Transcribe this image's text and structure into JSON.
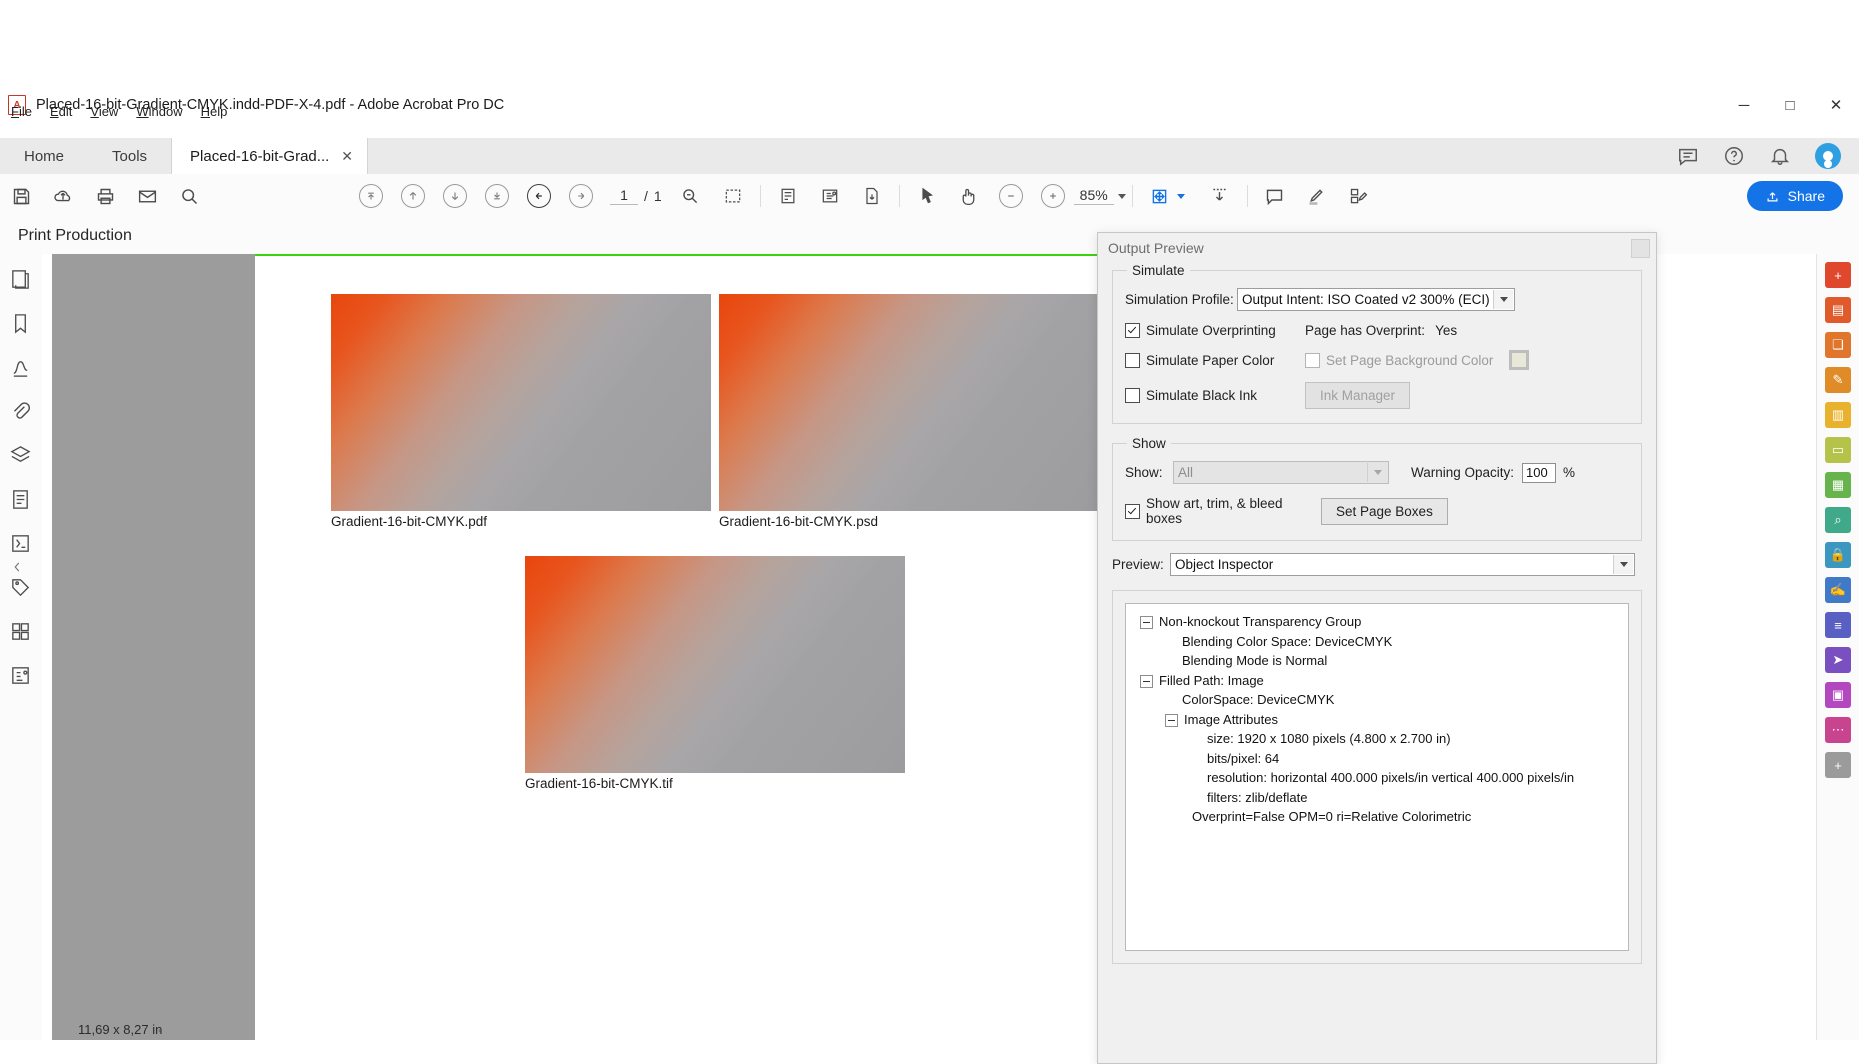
{
  "window": {
    "title": "Placed-16-bit-Gradient-CMYK.indd-PDF-X-4.pdf - Adobe Acrobat Pro DC",
    "app_icon": "pdf-document-icon",
    "minimize": "─",
    "maximize": "□",
    "close": "✕"
  },
  "menubar": {
    "items": [
      {
        "label": "File",
        "accel": "F"
      },
      {
        "label": "Edit",
        "accel": "E"
      },
      {
        "label": "View",
        "accel": "V"
      },
      {
        "label": "Window",
        "accel": "W"
      },
      {
        "label": "Help",
        "accel": "H"
      }
    ]
  },
  "tabs": {
    "home": "Home",
    "tools": "Tools",
    "document": "Placed-16-bit-Grad...",
    "close_glyph": "✕"
  },
  "toolbar": {
    "page_current": "1",
    "page_sep": "/",
    "page_total": "1",
    "zoom_level": "85%",
    "share_label": "Share"
  },
  "print_production": {
    "title": "Print Production"
  },
  "document": {
    "images": [
      {
        "caption": "Gradient-16-bit-CMYK.pdf"
      },
      {
        "caption": "Gradient-16-bit-CMYK.psd"
      },
      {
        "caption": "Gradient-16-bit-CMYK.tif"
      }
    ]
  },
  "statusbar": {
    "page_dimensions": "11,69 x 8,27 in",
    "scroll_left_glyph": "‹",
    "scroll_right_glyph": "›"
  },
  "output_preview": {
    "title": "Output Preview",
    "simulate": {
      "legend": "Simulate",
      "simulation_profile_label": "Simulation Profile:",
      "simulation_profile_value": "Output Intent: ISO Coated v2 300% (ECI)",
      "simulate_overprinting_label": "Simulate Overprinting",
      "simulate_overprinting_checked": true,
      "page_has_overprint_label": "Page has Overprint:",
      "page_has_overprint_value": "Yes",
      "simulate_paper_color_label": "Simulate Paper Color",
      "simulate_paper_color_checked": false,
      "set_page_background_color_label": "Set Page Background Color",
      "set_page_background_color_checked": false,
      "background_color_swatch": "#e8e8d8",
      "simulate_black_ink_label": "Simulate Black Ink",
      "simulate_black_ink_checked": false,
      "ink_manager_label": "Ink Manager"
    },
    "show": {
      "legend": "Show",
      "show_label": "Show:",
      "show_value": "All",
      "warning_opacity_label": "Warning Opacity:",
      "warning_opacity_value": "100",
      "warning_opacity_unit": "%",
      "show_boxes_label": "Show art, trim, & bleed boxes",
      "show_boxes_checked": true,
      "set_page_boxes_label": "Set Page Boxes"
    },
    "preview": {
      "label": "Preview:",
      "value": "Object Inspector"
    },
    "inspector": {
      "lines": [
        {
          "text": "Non-knockout Transparency Group",
          "indent": 0,
          "node": true
        },
        {
          "text": "Blending Color Space: DeviceCMYK",
          "indent": 1,
          "node": false
        },
        {
          "text": "Blending Mode is Normal",
          "indent": 1,
          "node": false
        },
        {
          "text": "Filled Path: Image",
          "indent": 0,
          "node": true
        },
        {
          "text": "ColorSpace: DeviceCMYK",
          "indent": 1,
          "node": false
        },
        {
          "text": "Image Attributes",
          "indent": 1,
          "node": true
        },
        {
          "text": "size: 1920 x 1080 pixels (4.800 x 2.700 in)",
          "indent": 2,
          "node": false
        },
        {
          "text": "bits/pixel: 64",
          "indent": 2,
          "node": false
        },
        {
          "text": "resolution: horizontal 400.000 pixels/in vertical 400.000 pixels/in",
          "indent": 2,
          "node": false
        },
        {
          "text": "filters: zlib/deflate",
          "indent": 2,
          "node": false
        },
        {
          "text": "Overprint=False OPM=0 ri=Relative Colorimetric",
          "indent": 1.4,
          "node": false
        }
      ]
    }
  },
  "colors": {
    "accent_blue": "#1473e6",
    "page_box_green": "#3dd20f",
    "gutter_gray": "#9c9c9c",
    "gradient_start": "#e8460d",
    "gradient_end": "#9c9c9e"
  }
}
